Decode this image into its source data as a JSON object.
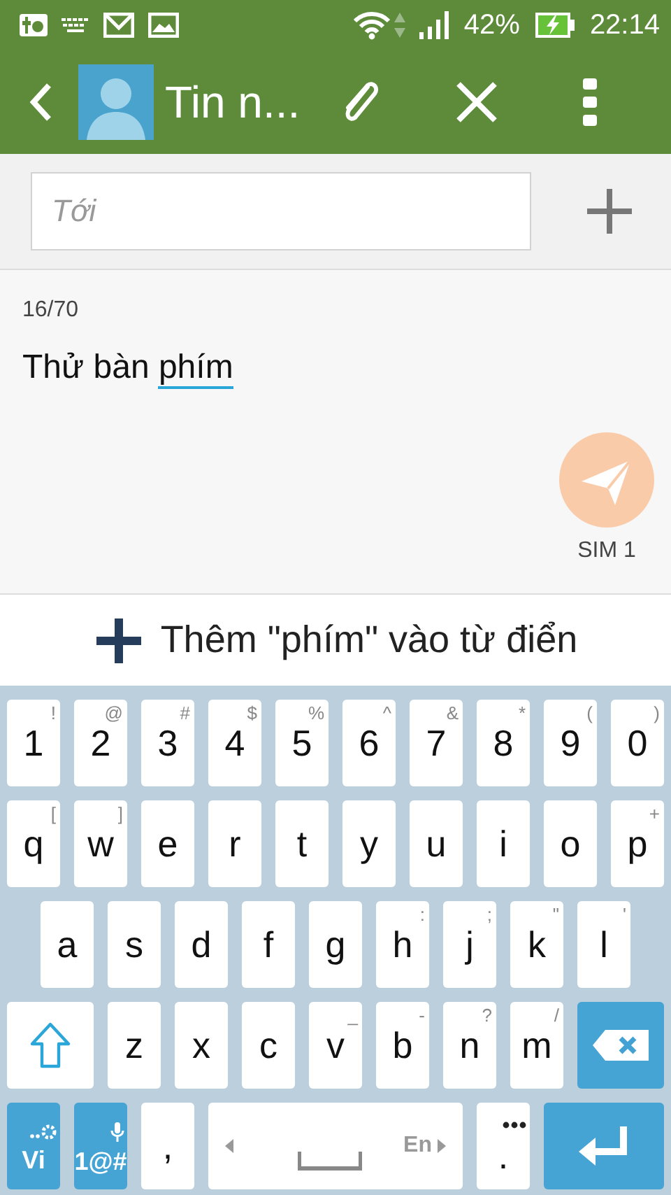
{
  "status_bar": {
    "battery": "42%",
    "time": "22:14"
  },
  "toolbar": {
    "title": "Tin n..."
  },
  "recipient": {
    "placeholder": "Tới"
  },
  "message": {
    "counter": "16/70",
    "segments": [
      {
        "text": "Thử bàn ",
        "underlined": false
      },
      {
        "text": "phím",
        "underlined": true
      }
    ],
    "sim_label": "SIM 1"
  },
  "suggestion": {
    "text": "Thêm \"phím\" vào từ điển"
  },
  "keyboard": {
    "rows": [
      [
        {
          "kind": "char",
          "label": "1",
          "hint": "!"
        },
        {
          "kind": "char",
          "label": "2",
          "hint": "@"
        },
        {
          "kind": "char",
          "label": "3",
          "hint": "#"
        },
        {
          "kind": "char",
          "label": "4",
          "hint": "$"
        },
        {
          "kind": "char",
          "label": "5",
          "hint": "%"
        },
        {
          "kind": "char",
          "label": "6",
          "hint": "^"
        },
        {
          "kind": "char",
          "label": "7",
          "hint": "&"
        },
        {
          "kind": "char",
          "label": "8",
          "hint": "*"
        },
        {
          "kind": "char",
          "label": "9",
          "hint": "("
        },
        {
          "kind": "char",
          "label": "0",
          "hint": ")"
        }
      ],
      [
        {
          "kind": "char",
          "label": "q",
          "hint": "["
        },
        {
          "kind": "char",
          "label": "w",
          "hint": "]"
        },
        {
          "kind": "char",
          "label": "e"
        },
        {
          "kind": "char",
          "label": "r"
        },
        {
          "kind": "char",
          "label": "t"
        },
        {
          "kind": "char",
          "label": "y"
        },
        {
          "kind": "char",
          "label": "u"
        },
        {
          "kind": "char",
          "label": "i"
        },
        {
          "kind": "char",
          "label": "o"
        },
        {
          "kind": "char",
          "label": "p",
          "hint": "+"
        }
      ],
      [
        {
          "kind": "char",
          "label": "a"
        },
        {
          "kind": "char",
          "label": "s"
        },
        {
          "kind": "char",
          "label": "d"
        },
        {
          "kind": "char",
          "label": "f"
        },
        {
          "kind": "char",
          "label": "g"
        },
        {
          "kind": "char",
          "label": "h",
          "hint": ":"
        },
        {
          "kind": "char",
          "label": "j",
          "hint": ";"
        },
        {
          "kind": "char",
          "label": "k",
          "hint": "\""
        },
        {
          "kind": "char",
          "label": "l",
          "hint": "'"
        }
      ],
      [
        {
          "kind": "shift"
        },
        {
          "kind": "char",
          "label": "z"
        },
        {
          "kind": "char",
          "label": "x"
        },
        {
          "kind": "char",
          "label": "c"
        },
        {
          "kind": "char",
          "label": "v",
          "hint": "_"
        },
        {
          "kind": "char",
          "label": "b",
          "hint": "-"
        },
        {
          "kind": "char",
          "label": "n",
          "hint": "?"
        },
        {
          "kind": "char",
          "label": "m",
          "hint": "/"
        },
        {
          "kind": "backspace"
        }
      ],
      [
        {
          "kind": "language",
          "label": "Vi"
        },
        {
          "kind": "symbols",
          "label": "1@#"
        },
        {
          "kind": "char",
          "label": ","
        },
        {
          "kind": "space",
          "label": "En"
        },
        {
          "kind": "period",
          "label": "."
        },
        {
          "kind": "enter"
        }
      ]
    ]
  }
}
